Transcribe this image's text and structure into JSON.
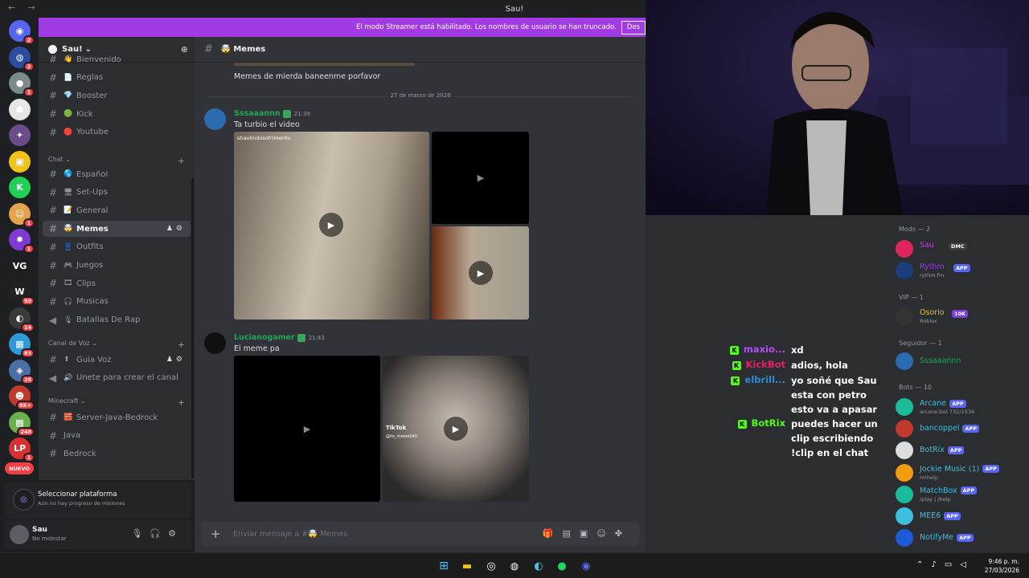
{
  "window": {
    "title": "Sau!",
    "nav": "← →"
  },
  "banner": {
    "text": "El modo Streamer está habilitado. Los nombres de usuario se han truncado.",
    "button": "Des"
  },
  "servers": [
    {
      "badge": "2",
      "color": "#5865f2",
      "glyph": "◉"
    },
    {
      "badge": "2",
      "color": "#2a4d9e",
      "glyph": "◍"
    },
    {
      "badge": "1",
      "color": "#7b8a8b",
      "glyph": "●"
    },
    {
      "badge": "",
      "color": "#e6e6e6",
      "glyph": "☗"
    },
    {
      "badge": "",
      "color": "#6b4c8a",
      "glyph": "✦"
    },
    {
      "badge": "",
      "color": "#f0c419",
      "glyph": "▣"
    },
    {
      "badge": "",
      "color": "#1fd255",
      "glyph": "K"
    },
    {
      "badge": "1",
      "color": "#e8a24a",
      "glyph": "☺"
    },
    {
      "badge": "1",
      "color": "#7d3bd1",
      "glyph": "✹"
    },
    {
      "badge": "",
      "color": "#1e1f22",
      "glyph": "VG"
    },
    {
      "badge": "50",
      "color": "#222",
      "glyph": "W"
    },
    {
      "badge": "14",
      "color": "#3a3a3a",
      "glyph": "◐"
    },
    {
      "badge": "83",
      "color": "#2d9bd8",
      "glyph": "▦"
    },
    {
      "badge": "28",
      "color": "#4a6fa5",
      "glyph": "◈"
    },
    {
      "badge": "9K+",
      "color": "#c0392b",
      "glyph": "☻"
    },
    {
      "badge": "248",
      "color": "#6ab04c",
      "glyph": "▩"
    },
    {
      "badge": "1",
      "color": "#d63031",
      "glyph": "LP"
    }
  ],
  "nuevo": "NUEVO",
  "guild": {
    "name": "Sau!",
    "chevron": "⌄"
  },
  "channels_top": [
    {
      "emoji": "👋",
      "name": "Bienvenido"
    },
    {
      "emoji": "📄",
      "name": "Reglas"
    },
    {
      "emoji": "💎",
      "name": "Booster"
    },
    {
      "emoji": "🟢",
      "name": "Kick"
    },
    {
      "emoji": "🔴",
      "name": "Youtube"
    }
  ],
  "cat_chat": "Chat",
  "channels_chat": [
    {
      "emoji": "🌎",
      "name": "Español"
    },
    {
      "emoji": "🖥",
      "name": "Set-Ups"
    },
    {
      "emoji": "📝",
      "name": "General"
    },
    {
      "emoji": "🤯",
      "name": "Memes",
      "active": true
    },
    {
      "emoji": "👖",
      "name": "Outfits"
    },
    {
      "emoji": "🎮",
      "name": "Juegos"
    },
    {
      "emoji": "🎞",
      "name": "Clips"
    },
    {
      "emoji": "🎧",
      "name": "Musicas"
    },
    {
      "emoji": "🎙",
      "name": "Batallas De Rap"
    }
  ],
  "cat_voz": "Canal de Voz",
  "channels_voz": [
    {
      "emoji": "⬆",
      "name": "Guia Voz"
    },
    {
      "emoji": "🔊",
      "name": "Unete para crear el canal"
    }
  ],
  "cat_mc": "Minecraft",
  "channels_mc": [
    {
      "emoji": "🧱",
      "name": "Server-Java-Bedrock"
    },
    {
      "emoji": "",
      "name": "Java"
    },
    {
      "emoji": "",
      "name": "Bedrock"
    }
  ],
  "quest": {
    "title": "Seleccionar plataforma",
    "sub": "Aún no hay progreso de misiones"
  },
  "user": {
    "name": "Sau",
    "status": "No molestar"
  },
  "chat": {
    "channel": "Memes",
    "prev_text": "Memes de mierda baneenme porfavor",
    "date": "27 de marzo de 2026",
    "msg1": {
      "author": "Sssaaannn",
      "time": "21:39",
      "text": "Ta turbio el video",
      "watermark": "shaolindosofrimento"
    },
    "msg2": {
      "author": "Lucianogamer",
      "time": "21:43",
      "text": "El meme pa",
      "watermark": "TikTok",
      "watermark2": "@its_meme040"
    },
    "placeholder": "Enviar mensaje a #🤯 Memes"
  },
  "overlay": [
    {
      "user": "maxio...",
      "text": "xd",
      "color": "#b74bfb"
    },
    {
      "user": "KickBot",
      "text": "adios, hola",
      "color": "#e0206a"
    },
    {
      "user": "elbrill...",
      "text": "yo soñé que Sau esta con petro esto va a apasar",
      "color": "#2a8bd6"
    },
    {
      "user": "BotRix",
      "text": "puedes hacer un clip escribiendo !clip en el chat",
      "color": "#53fc18"
    }
  ],
  "members": {
    "mods": "Mods — 2",
    "m1": {
      "name": "Sau",
      "tag": "DMC"
    },
    "m2": {
      "name": "Rythm",
      "sub": "rythm.fm",
      "app": "APP"
    },
    "vip": "VIP — 1",
    "m3": {
      "name": "Osorio",
      "tag": "10K",
      "sub": "Roblox"
    },
    "seg": "Seguidor — 1",
    "m4": {
      "name": "Sssaaannn"
    },
    "bots": "Bots — 10",
    "b1": {
      "name": "Arcane",
      "sub": "arcane.bot 732/1536"
    },
    "b2": {
      "name": "bancoppel"
    },
    "b3": {
      "name": "BotRix"
    },
    "b4": {
      "name": "Jockie Music (1)",
      "sub": "m!help"
    },
    "b5": {
      "name": "MatchBox",
      "sub": "/play | /help"
    },
    "b6": {
      "name": "MEE6"
    },
    "b7": {
      "name": "NotifyMe"
    },
    "app": "APP"
  },
  "clock": {
    "time": "9:46 p. m.",
    "date": "27/03/2026"
  }
}
